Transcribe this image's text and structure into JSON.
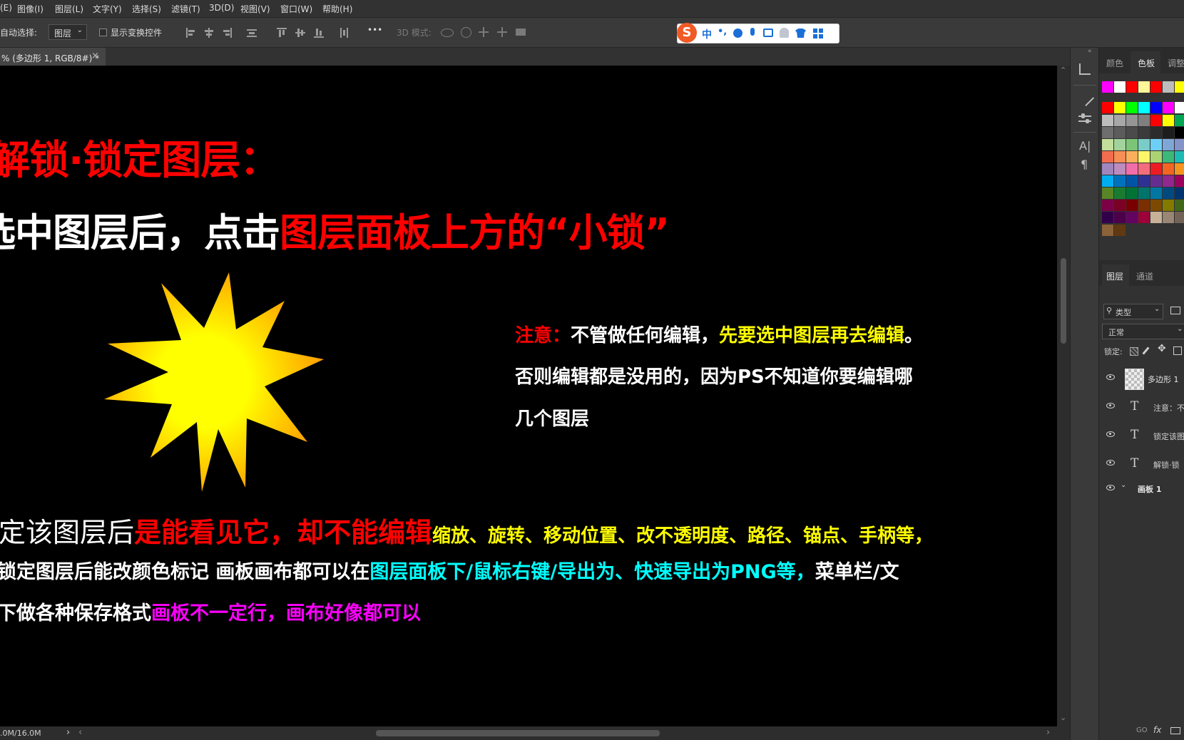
{
  "menu": [
    "(E)",
    "图像(I)",
    "图层(L)",
    "文字(Y)",
    "选择(S)",
    "滤镜(T)",
    "3D(D)",
    "视图(V)",
    "窗口(W)",
    "帮助(H)"
  ],
  "options": {
    "auto_select_label": "自动选择:",
    "auto_select_value": "图层",
    "show_transform_label": "显示变换控件",
    "more": "•••",
    "mode_3d": "3D 模式:"
  },
  "ime": {
    "lang": "中",
    "punct": "•,"
  },
  "document_tab": {
    "title": "% (多边形 1, RGB/8#) *",
    "close": "×"
  },
  "canvas": {
    "heading": "解锁·锁定图层：",
    "line2_white": "选中图层后，点击",
    "line2_red": "图层面板上方的“小锁”",
    "note_label": "注意：",
    "note_white1": "不管做任何编辑，",
    "note_yellow": "先要选中图层再去编辑",
    "note_white2": "。",
    "note_line2": "否则编辑都是没用的，因为PS不知道你要编辑哪",
    "note_line3": "几个图层",
    "lock_white": "定该图层后",
    "lock_red": "是能看见它，却不能编辑",
    "lock_yellow": "缩放、旋转、移动位置、改不透明度、路径、锚点、手柄等，",
    "export_white1": "锁定图层后能改颜色标记  画板画布都可以在",
    "export_cyan": "图层面板下/鼠标右键/导出为、快速导出为PNG等，",
    "export_white2": "菜单栏/文",
    "save_white": "下做各种保存格式",
    "save_magenta": "画板不一定行，画布好像都可以"
  },
  "status": {
    "doc_size": ".0M/16.0M",
    "arrow": "›",
    "left_arrow": "‹"
  },
  "panels": {
    "top_tabs": [
      "颜色",
      "色板",
      "调整"
    ],
    "layers_tabs": [
      "图层",
      "通道"
    ],
    "filter_kind": "类型",
    "blend_mode": "正常",
    "lock_label": "锁定:",
    "layers": [
      {
        "name": "多边形 1",
        "kind": "shape"
      },
      {
        "name": "注意：不",
        "kind": "text"
      },
      {
        "name": "锁定该图",
        "kind": "text"
      },
      {
        "name": "解锁·锁",
        "kind": "text"
      }
    ],
    "artboard": "画板 1",
    "bottom_icons": [
      "GO",
      "fx"
    ]
  },
  "colors": {
    "red": "#ff0000",
    "yellow": "#ffff00",
    "cyan": "#00ffff",
    "magenta": "#ff00ff",
    "white": "#ffffff"
  }
}
